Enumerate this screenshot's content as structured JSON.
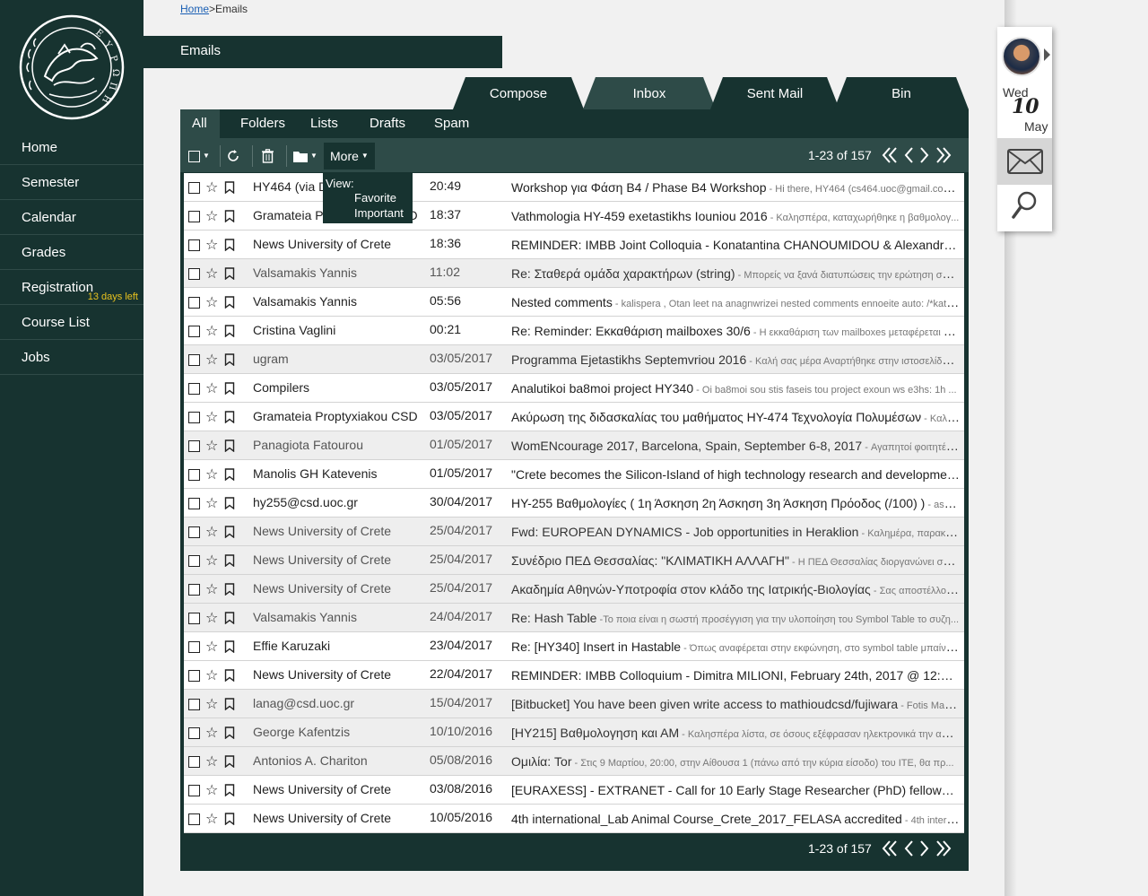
{
  "breadcrumb": {
    "home": "Home",
    "sep": ">",
    "current": "Emails"
  },
  "page_title": "Emails",
  "nav": [
    {
      "label": "Home"
    },
    {
      "label": "Semester"
    },
    {
      "label": "Calendar"
    },
    {
      "label": "Grades"
    },
    {
      "label": "Registration",
      "badge": "13 days left"
    },
    {
      "label": "Course List"
    },
    {
      "label": "Jobs"
    }
  ],
  "top_tabs": [
    "Compose",
    "Inbox",
    "Sent Mail",
    "Bin"
  ],
  "active_top_tab": "Inbox",
  "sub_tabs": [
    "All",
    "Folders",
    "Lists",
    "Drafts",
    "Spam"
  ],
  "toolbar": {
    "more_label": "More"
  },
  "more_menu": {
    "view_label": "View:",
    "favorite": "Favorite",
    "important": "Important"
  },
  "pager": {
    "range": "1-23 of 157"
  },
  "widget": {
    "weekday": "Wed",
    "day": "10",
    "month": "May"
  },
  "emails": [
    {
      "sender": "HY464 (via Drive)",
      "date": "20:49",
      "subject": "Workshop για Φάση Β4 / Phase B4 Workshop",
      "preview": " - Hi there, HY464 (cs464.uoc@gmail.com) is co...",
      "read": false
    },
    {
      "sender": "Gramateia Proptyxiakou CSD",
      "date": "18:37",
      "subject": "Vathmologia HY-459 exetastikhs Iouniou 2016",
      "preview": "  - Καλησπέρα, καταχωρήθηκε η βαθμολογ...",
      "read": false
    },
    {
      "sender": "News University of Crete",
      "date": "18:36",
      "subject": "REMINDER: IMBB Joint Colloquia - Konatantina CHANOUMIDOU & Alexandra KOU...",
      "preview": "",
      "read": false
    },
    {
      "sender": "Valsamakis Yannis",
      "date": "11:02",
      "subject": "Re: Σταθερά ομάδα χαρακτήρων (string)",
      "preview": " - Μπορείς να ξανά διατυπώσεις την ερώτηση σου ...",
      "read": true
    },
    {
      "sender": "Valsamakis Yannis",
      "date": "05:56",
      "subject": "Nested comments",
      "preview": "  - kalispera , Otan leet na anagnwrizei nested comments ennoeite auto: /*kati/*...",
      "read": false
    },
    {
      "sender": "Cristina Vaglini",
      "date": "00:21",
      "subject": "Re: Reminder: Εκκαθάριση mailboxes 30/6",
      "preview": " - Η εκκαθάριση των mailboxes μεταφέρεται το ...",
      "read": false
    },
    {
      "sender": "ugram",
      "date": "03/05/2017",
      "subject": "Programma Ejetastikhs Septemvriou 2016",
      "preview": "  - Καλή σας μέρα Αναρτήθηκε στην ιστοσελίδα το...",
      "read": true
    },
    {
      "sender": "Compilers",
      "date": "03/05/2017",
      "subject": "Analutikoi ba8moi project HY340",
      "preview": "  - Oi ba8moi sou stis faseis tou project exoun ws e3hs: 1h       ...",
      "read": false
    },
    {
      "sender": "Gramateia Proptyxiakou CSD",
      "date": "03/05/2017",
      "subject": "Ακύρωση της διδασκαλίας του μαθήματος ΗΥ-474 Τεχνολογία Πολυμέσων",
      "preview": "  - Καλησπ...",
      "read": false
    },
    {
      "sender": "Panagiota Fatourou",
      "date": "01/05/2017",
      "subject": "WomENcourage 2017, Barcelona, Spain, September 6-8, 2017",
      "preview": " - Αγαπητοί φοιτητές/φοιτή...",
      "read": true
    },
    {
      "sender": "Manolis GH Katevenis",
      "date": "01/05/2017",
      "subject": "\"Crete becomes the Silicon-Island of high technology research and development\", s...",
      "preview": "",
      "read": false
    },
    {
      "sender": "hy255@csd.uoc.gr",
      "date": "30/04/2017",
      "subject": "HY-255 Βαθμολογίες ( 1η Άσκηση 2η Άσκηση 3η Άσκηση Πρόοδος (/100) )",
      "preview": "  - askisi 1 ...",
      "read": false
    },
    {
      "sender": "News University of Crete",
      "date": "25/04/2017",
      "subject": "Fwd: EUROPEAN DYNAMICS - Job opportunities in Heraklion",
      "preview": " - Καλημέρα, παρακαλώ δείτε...",
      "read": true
    },
    {
      "sender": "News University of Crete",
      "date": "25/04/2017",
      "subject": "Συνέδριο ΠΕΔ Θεσσαλίας: \"ΚΛΙΜΑΤΙΚΗ ΑΛΛΑΓΗ\"",
      "preview": "  - Η ΠΕΔ Θεσσαλίας διοργανώνει συνέδριο...",
      "read": true
    },
    {
      "sender": "News University of Crete",
      "date": "25/04/2017",
      "subject": "Ακαδημία Αθηνών-Υποτροφία στον κλάδο της Ιατρικής-Βιολογίας",
      "preview": " -  Σας αποστέλλουμε ...",
      "read": true
    },
    {
      "sender": "Valsamakis Yannis",
      "date": "24/04/2017",
      "subject": "Re: Hash Table",
      "preview": "  -Το ποια είναι η σωστή προσέγγιση για την υλοποίηση του Symbol Table το συζη...",
      "read": true
    },
    {
      "sender": "Effie Karuzaki",
      "date": "23/04/2017",
      "subject": "Re: [HY340] Insert in Hastable",
      "preview": "  - Όπως αναφέρεται στην εκφώνηση, στο symbol table μπαίνου...",
      "read": false
    },
    {
      "sender": "News University of Crete",
      "date": "22/04/2017",
      "subject": "REMINDER: IMBB Colloquium - Dimitra MILIONI, February 24th, 2017 @ 12:00",
      "preview": "  - Hello, ...",
      "read": false
    },
    {
      "sender": "lanag@csd.uoc.gr",
      "date": "15/04/2017",
      "subject": "[Bitbucket] You have been given write access to mathioudcsd/fujiwara",
      "preview": " - Fotis Mathiouda...",
      "read": true
    },
    {
      "sender": "George Kafentzis",
      "date": "10/10/2016",
      "subject": "[HY215] Βαθμολογηση και ΑΜ",
      "preview": "  - Καλησπέρα λίστα, σε όσους εξέφρασαν ηλεκτρονικά την απορ...",
      "read": true
    },
    {
      "sender": "Antonios A. Chariton",
      "date": "05/08/2016",
      "subject": "Ομιλία: Tor",
      "preview": "  - Στις 9 Μαρτίου, 20:00, στην Αίθουσα 1 (πάνω από την κύρια είσοδο) του ΙΤΕ, θα πρ...",
      "read": true
    },
    {
      "sender": "News University of Crete",
      "date": "03/08/2016",
      "subject": "[EURAXESS] - EXTRANET - Call for 10 Early Stage Researcher (PhD) fellowships with...",
      "preview": "",
      "read": false
    },
    {
      "sender": "News University of Crete",
      "date": "10/05/2016",
      "subject": "4th international_Lab Animal Course_Crete_2017_FELASA accredited",
      "preview": "  - 4th international...",
      "read": false
    }
  ]
}
